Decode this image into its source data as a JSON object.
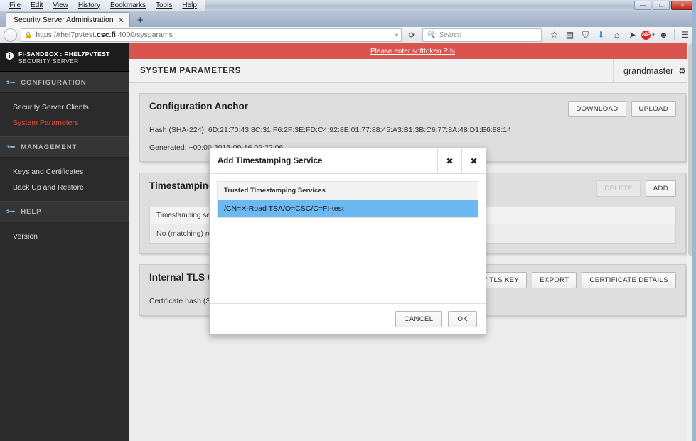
{
  "browser": {
    "menus": [
      "File",
      "Edit",
      "View",
      "History",
      "Bookmarks",
      "Tools",
      "Help"
    ],
    "window_controls": {
      "minimize": "—",
      "maximize": "□",
      "close": "✕"
    },
    "tab": {
      "title": "Security Server Administration",
      "close": "✕"
    },
    "new_tab": "+",
    "back": "←",
    "reload": "⟳",
    "url_prefix": "https://rhel7pvtest.",
    "url_bold": "csc.fi",
    "url_suffix": ":4000/sysparams",
    "lock_icon": "lock-icon",
    "url_dropdown": "▾",
    "search_placeholder": "Search",
    "search_icon": "search-icon",
    "toolbar_icons": [
      {
        "name": "bookmark-star-icon",
        "glyph": "☆"
      },
      {
        "name": "reader-list-icon",
        "glyph": "▤"
      },
      {
        "name": "pocket-icon",
        "glyph": "⛉"
      },
      {
        "name": "downloads-icon",
        "glyph": "⬇"
      },
      {
        "name": "home-icon",
        "glyph": "⌂"
      },
      {
        "name": "sync-send-icon",
        "glyph": "➤"
      },
      {
        "name": "adblock-plus-icon",
        "glyph": "ABP"
      },
      {
        "name": "chat-icon",
        "glyph": "☻"
      },
      {
        "name": "hamburger-menu-icon",
        "glyph": "☰"
      }
    ]
  },
  "sidebar": {
    "header": {
      "icon": "info-circle-icon",
      "line1": "FI-SANDBOX : RHEL7PVTEST",
      "line2": "SECURITY SERVER"
    },
    "groups": [
      {
        "icon": "wrench-icon",
        "label": "CONFIGURATION",
        "items": [
          {
            "label": "Security Server Clients",
            "active": false
          },
          {
            "label": "System Parameters",
            "active": true
          }
        ]
      },
      {
        "icon": "wrench-icon",
        "label": "MANAGEMENT",
        "items": [
          {
            "label": "Keys and Certificates",
            "active": false
          },
          {
            "label": "Back Up and Restore",
            "active": false
          }
        ]
      },
      {
        "icon": "wrench-icon",
        "label": "HELP",
        "items": [
          {
            "label": "Version",
            "active": false
          }
        ]
      }
    ]
  },
  "alert": {
    "text": "Please enter softtoken PIN",
    "bg": "#d9534f"
  },
  "header": {
    "title": "SYSTEM PARAMETERS",
    "user": "grandmaster",
    "gear_icon": "gear-icon"
  },
  "panels": {
    "anchor": {
      "title": "Configuration Anchor",
      "buttons": [
        {
          "label": "DOWNLOAD",
          "disabled": false
        },
        {
          "label": "UPLOAD",
          "disabled": false
        }
      ],
      "hash": "Hash (SHA-224): 6D:21:70:43:8C:31:F6:2F:3E:FD:C4:92:8E:01:77:88:45:A3:B1:3B:C6:77:8A:48:D1:E6:88:14",
      "generated": "Generated: +00:00 2015-09-16 09:22:06"
    },
    "timestamping": {
      "title": "Timestamping S",
      "buttons": [
        {
          "label": "DELETE",
          "disabled": true
        },
        {
          "label": "ADD",
          "disabled": false
        }
      ],
      "column": "Timestamping service",
      "empty_row": "No (matching) recor"
    },
    "tls": {
      "title": "Internal TLS Cer",
      "buttons": [
        {
          "label": "RATE NEW TLS KEY",
          "disabled": false
        },
        {
          "label": "EXPORT",
          "disabled": false
        },
        {
          "label": "CERTIFICATE DETAILS",
          "disabled": false
        }
      ],
      "hash": "Certificate hash (SHA"
    }
  },
  "modal": {
    "title": "Add Timestamping Service",
    "close_icon_1": "✖",
    "close_icon_2": "✖",
    "list_header": "Trusted Timestamping Services",
    "selected_item": "/CN=X-Road TSA/O=CSC/C=FI-test",
    "selected_bg": "#6cb8f0",
    "cancel": "CANCEL",
    "ok": "OK"
  }
}
